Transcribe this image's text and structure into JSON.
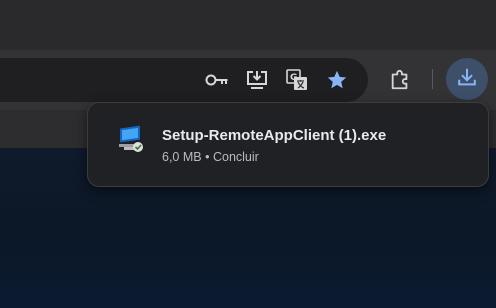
{
  "toolbar": {
    "icons": [
      "key-icon",
      "install-app-icon",
      "translate-icon",
      "star-bookmark-icon",
      "extensions-puzzle-icon",
      "download-icon"
    ],
    "accent_color": "#8ab4f8"
  },
  "download_bubble": {
    "file_name": "Setup-RemoteAppClient (1).exe",
    "size": "6,0 MB",
    "separator": "•",
    "status": "Concluir"
  }
}
